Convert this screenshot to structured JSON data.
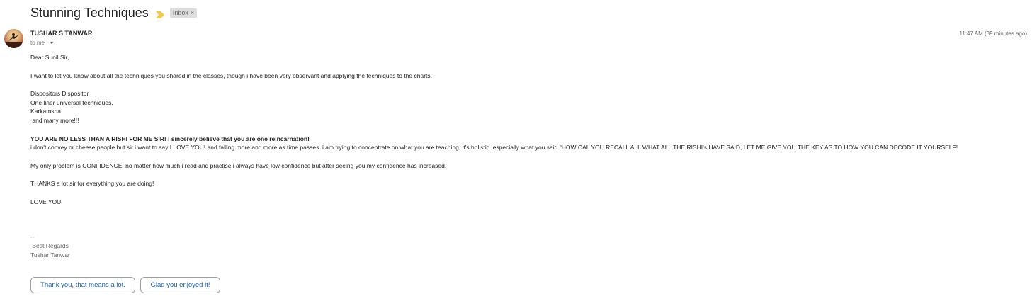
{
  "email": {
    "subject": "Stunning Techniques",
    "label": "Inbox",
    "label_close": "×",
    "importance_color": "#f2c94c",
    "sender": "TUSHAR S TANWAR",
    "recipient": "to me",
    "timestamp": "11:47 AM (39 minutes ago)",
    "body": {
      "greeting": "Dear Sunil Sir,",
      "intro": "I want to let you know about all the techniques you shared in the classes, though i have been very observant and applying the techniques to the charts.",
      "list": [
        "Dispositors Dispositor",
        "One liner universal techniques.",
        "Karkamsha",
        " and many more!!!"
      ],
      "bold_line": "YOU ARE NO LESS THAN A RISHI FOR ME SIR! i sincerely believe that you are one reincarnation!",
      "para1": "i don't convey or cheese people but sir i want to say I LOVE YOU! and falling more and more as time passes. i am trying to concentrate on what you are teaching, it's holistic. especially what you said \"HOW CAL YOU RECALL ALL WHAT ALL THE RISHI's HAVE SAID, LET ME GIVE YOU THE KEY AS TO HOW YOU CAN DECODE IT YOURSELF!",
      "para2": "My only problem is CONFIDENCE, no matter how much i read and practise i always have low confidence but after seeing you my confidence has increased.",
      "para3": "THANKS a lot sir for everything you are doing!",
      "para4": "LOVE YOU!"
    },
    "signature": {
      "separator": "--",
      "regards": " Best Regards",
      "name": "Tushar Tanwar"
    }
  },
  "smart_replies": [
    "Thank you, that means a lot.",
    "Glad you enjoyed it!"
  ]
}
